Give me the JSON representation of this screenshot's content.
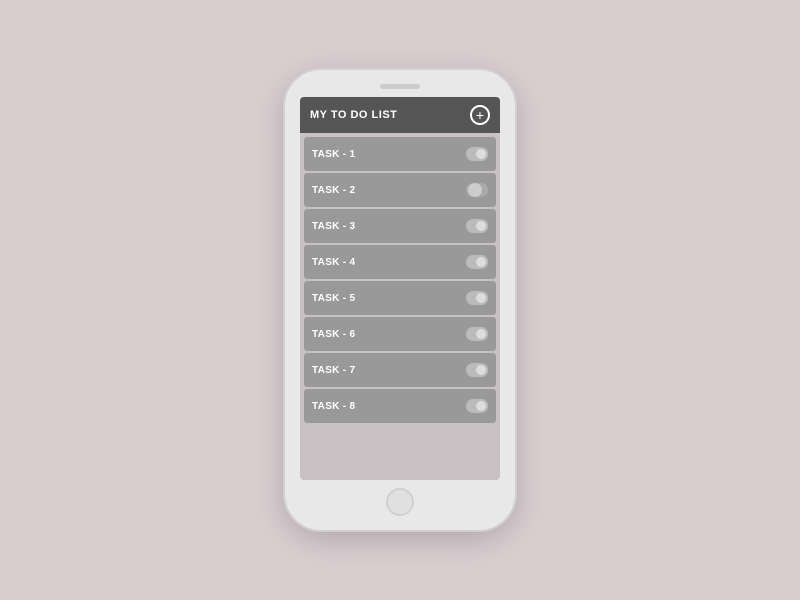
{
  "app": {
    "title": "MY TO DO LIST",
    "add_button_label": "+"
  },
  "tasks": [
    {
      "id": 1,
      "label": "TASK - 1",
      "active": false
    },
    {
      "id": 2,
      "label": "TASK - 2",
      "active": true
    },
    {
      "id": 3,
      "label": "TASK - 3",
      "active": false
    },
    {
      "id": 4,
      "label": "TASK - 4",
      "active": false
    },
    {
      "id": 5,
      "label": "TASK - 5",
      "active": false
    },
    {
      "id": 6,
      "label": "TASK - 6",
      "active": false
    },
    {
      "id": 7,
      "label": "TASK - 7",
      "active": false
    },
    {
      "id": 8,
      "label": "TASK - 8",
      "active": false
    }
  ],
  "colors": {
    "background": "#d9cdd0",
    "phone_body": "#e8e8e8",
    "header_bg": "#555555",
    "task_bg": "#999999",
    "header_text": "#ffffff",
    "task_text": "#ffffff"
  }
}
